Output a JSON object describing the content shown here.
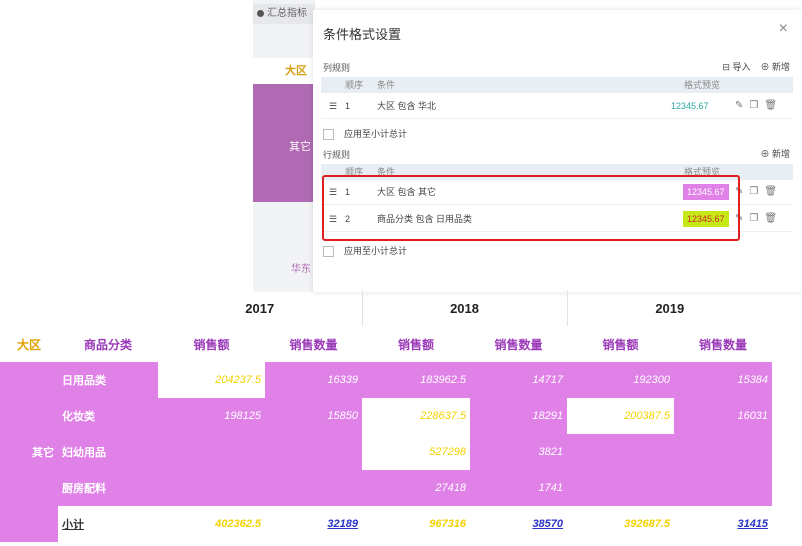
{
  "background": {
    "tab_label": "汇总指标",
    "region_header": "大区",
    "region_other": "其它",
    "region_north": "华东"
  },
  "dialog": {
    "title": "条件格式设置",
    "close": "×",
    "column_rules": {
      "label": "列规则",
      "import_label": "导入",
      "new_label": "新增",
      "headers": {
        "order": "顺序",
        "condition": "条件",
        "preview": "格式预览"
      },
      "rows": [
        {
          "order": "1",
          "condition": "大区 包含 华北",
          "preview": "12345.67",
          "bg": "#ffffff",
          "color": "#2ba8a0"
        }
      ],
      "apply_subtotal": "应用至小计总计"
    },
    "row_rules": {
      "label": "行规则",
      "new_label": "新增",
      "headers": {
        "order": "顺序",
        "condition": "条件",
        "preview": "格式预览"
      },
      "rows": [
        {
          "order": "1",
          "condition": "大区 包含 其它",
          "preview": "12345.67",
          "bg": "#e081e8",
          "color": "#ffffff"
        },
        {
          "order": "2",
          "condition": "商品分类 包含 日用品类",
          "preview": "12345.67",
          "bg": "#c6e817",
          "color": "#cc2b2b"
        }
      ],
      "apply_subtotal": "应用至小计总计"
    }
  },
  "table": {
    "years": [
      "2017",
      "2018",
      "2019"
    ],
    "col_headers": {
      "region": "大区",
      "category": "商品分类",
      "sales": "销售额",
      "qty": "销售数量"
    },
    "region": "其它",
    "rows": [
      {
        "category": "日用品类",
        "values": [
          "204237.5",
          "16339",
          "183962.5",
          "14717",
          "192300",
          "15384"
        ]
      },
      {
        "category": "化妆类",
        "values": [
          "198125",
          "15850",
          "228637.5",
          "18291",
          "200387.5",
          "16031"
        ]
      },
      {
        "category": "妇幼用品",
        "values": [
          "",
          "",
          "527298",
          "3821",
          "",
          ""
        ]
      },
      {
        "category": "厨房配料",
        "values": [
          "",
          "",
          "27418",
          "1741",
          "",
          ""
        ]
      }
    ],
    "subtotal": {
      "label": "小计",
      "values": [
        "402362.5",
        "32189",
        "967316",
        "38570",
        "392687.5",
        "31415"
      ]
    }
  }
}
